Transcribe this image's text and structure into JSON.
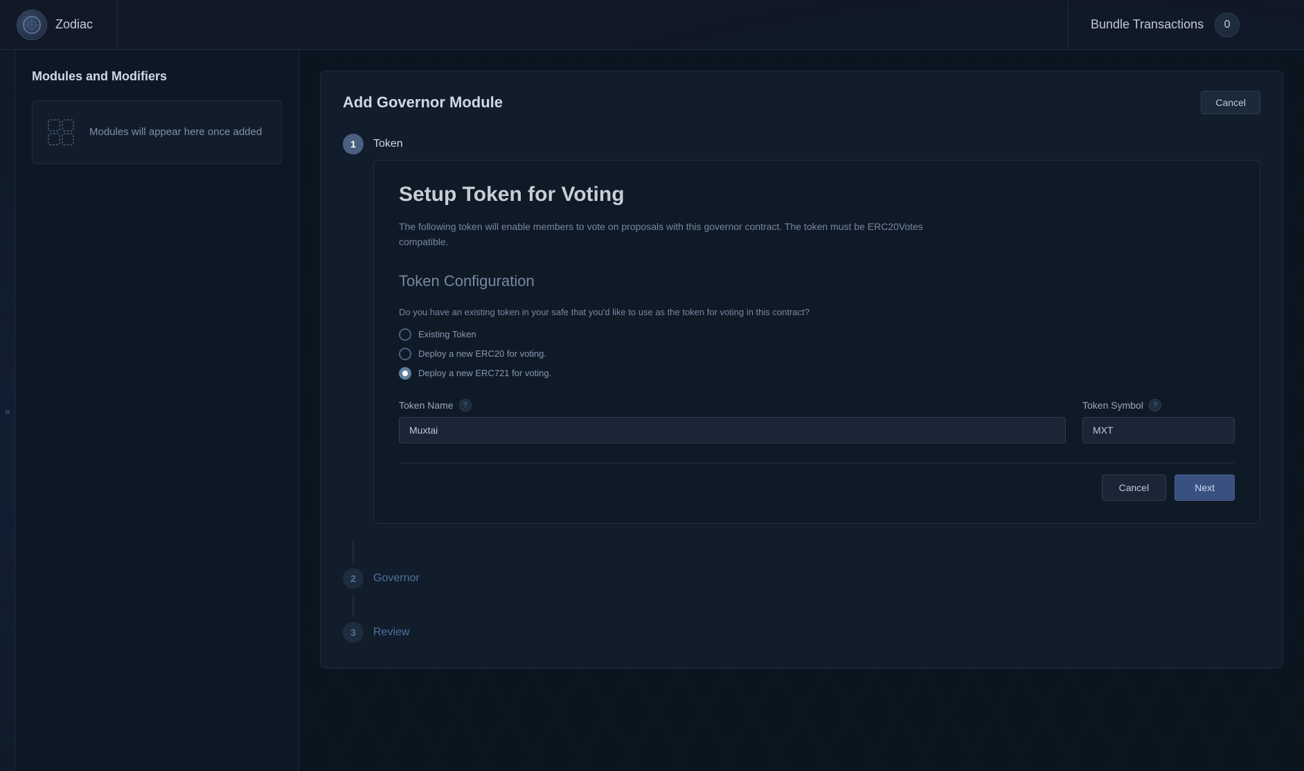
{
  "app": {
    "name": "Zodiac"
  },
  "topNav": {
    "logo_text": "Zodiac",
    "bundle_label": "Bundle Transactions",
    "bundle_count": "0"
  },
  "sidebar": {
    "title": "Modules and Modifiers",
    "empty_text": "Modules will appear here once added",
    "toggle_icon": "»"
  },
  "governorPanel": {
    "title": "Add Governor Module",
    "cancel_top_label": "Cancel"
  },
  "steps": [
    {
      "number": "1",
      "label": "Token",
      "state": "active"
    },
    {
      "number": "2",
      "label": "Governor",
      "state": "inactive"
    },
    {
      "number": "3",
      "label": "Review",
      "state": "inactive"
    }
  ],
  "tokenSetup": {
    "title": "Setup Token for Voting",
    "description": "The following token will enable members to vote on proposals with this governor contract. The token must be ERC20Votes compatible.",
    "config_title": "Token Configuration",
    "config_question": "Do you have an existing token in your safe that you'd like to use as the token for voting in this contract?",
    "radio_options": [
      {
        "id": "existing",
        "label": "Existing Token",
        "selected": false
      },
      {
        "id": "erc20",
        "label": "Deploy a new ERC20 for voting.",
        "selected": false
      },
      {
        "id": "erc721",
        "label": "Deploy a new ERC721 for voting.",
        "selected": true
      }
    ],
    "token_name_label": "Token Name",
    "token_name_value": "Muxtai",
    "token_symbol_label": "Token Symbol",
    "token_symbol_value": "MXT",
    "cancel_label": "Cancel",
    "next_label": "Next"
  }
}
